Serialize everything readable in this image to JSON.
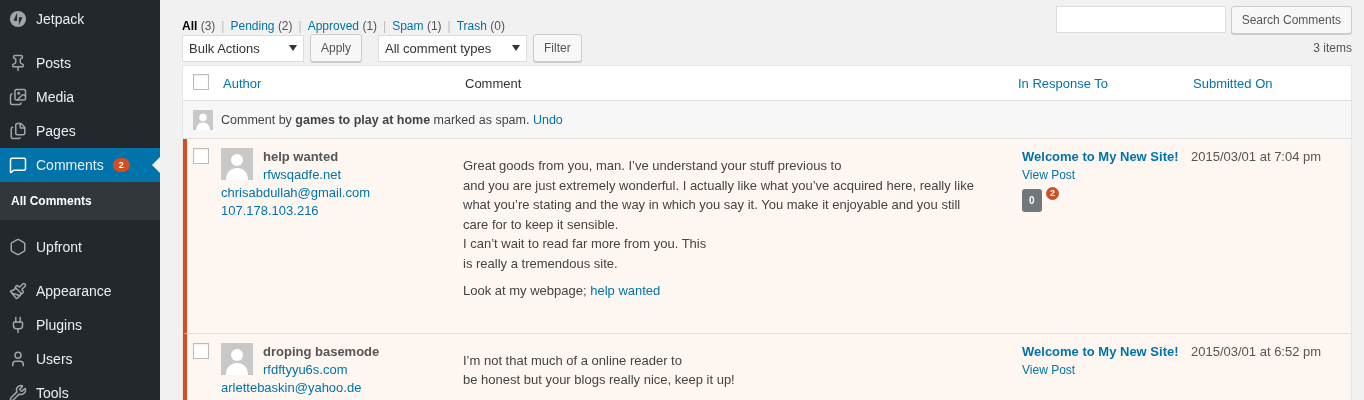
{
  "sidebar": {
    "items": [
      {
        "label": "Jetpack",
        "selected": false
      },
      {
        "label": "Posts",
        "selected": false
      },
      {
        "label": "Media",
        "selected": false
      },
      {
        "label": "Pages",
        "selected": false
      },
      {
        "label": "Comments",
        "selected": true,
        "badge": "2",
        "children": [
          {
            "label": "All Comments",
            "selected": true
          }
        ]
      },
      {
        "label": "Upfront",
        "selected": false
      },
      {
        "label": "Appearance",
        "selected": false
      },
      {
        "label": "Plugins",
        "selected": false
      },
      {
        "label": "Users",
        "selected": false
      },
      {
        "label": "Tools",
        "selected": false
      }
    ]
  },
  "views": {
    "separator": "|",
    "items": [
      {
        "label": "All",
        "count": "(3)",
        "selected": true
      },
      {
        "label": "Pending",
        "count": "(2)",
        "selected": false
      },
      {
        "label": "Approved",
        "count": "(1)",
        "selected": false
      },
      {
        "label": "Spam",
        "count": "(1)",
        "selected": false
      },
      {
        "label": "Trash",
        "count": "(0)",
        "selected": false
      }
    ]
  },
  "search": {
    "button": "Search Comments"
  },
  "tablenav": {
    "bulk_actions": "Bulk Actions",
    "apply": "Apply",
    "comment_type": "All comment types",
    "filter": "Filter",
    "items_count": "3 items"
  },
  "table": {
    "select_all": {
      "checked": false
    },
    "columns": [
      {
        "label": "Author",
        "sortable": true
      },
      {
        "label": "Comment",
        "sortable": false
      },
      {
        "label": "In Response To",
        "sortable": true
      },
      {
        "label": "Submitted On",
        "sortable": true
      }
    ],
    "notice": {
      "text": "Comment by **games to play at home** marked as spam.",
      "link": "Undo"
    },
    "rows": [
      {
        "checked": false,
        "unapproved": true,
        "author": {
          "name": "help wanted",
          "url": "rfwsqadfe.net",
          "email": "chrisabdullah@gmail.com",
          "ip": "107.178.103.216"
        },
        "comment": {
          "paragraphs": [
            [
              "Great goods from you, man. I’ve understand your stuff previous to",
              "and you are just extremely wonderful. I actually like what you’ve acquired here, really like",
              "what you’re stating and the way in which you say it. You make it enjoyable and you still",
              "care for to keep it sensible.",
              "I can’t wait to read far more from you. This",
              "is really a tremendous site."
            ]
          ],
          "link_prefix": "Look at my webpage; ",
          "link": "help wanted"
        },
        "response": {
          "post": "Welcome to My New Site!",
          "view": "View Post",
          "approved_count": "0",
          "pending_count": "2"
        },
        "submitted": "2015/03/01 at 7:04 pm"
      },
      {
        "checked": false,
        "unapproved": true,
        "author": {
          "name": "droping basemode",
          "url": "rfdftyyu6s.com",
          "email": "arlettebaskin@yahoo.de"
        },
        "comment": {
          "paragraphs": [
            [
              "I’m not that much of a online reader to",
              "be honest but your blogs really nice, keep it up!"
            ]
          ]
        },
        "response": {
          "post": "Welcome to My New Site!",
          "view": "View Post"
        },
        "submitted": "2015/03/01 at 6:52 pm"
      }
    ]
  }
}
